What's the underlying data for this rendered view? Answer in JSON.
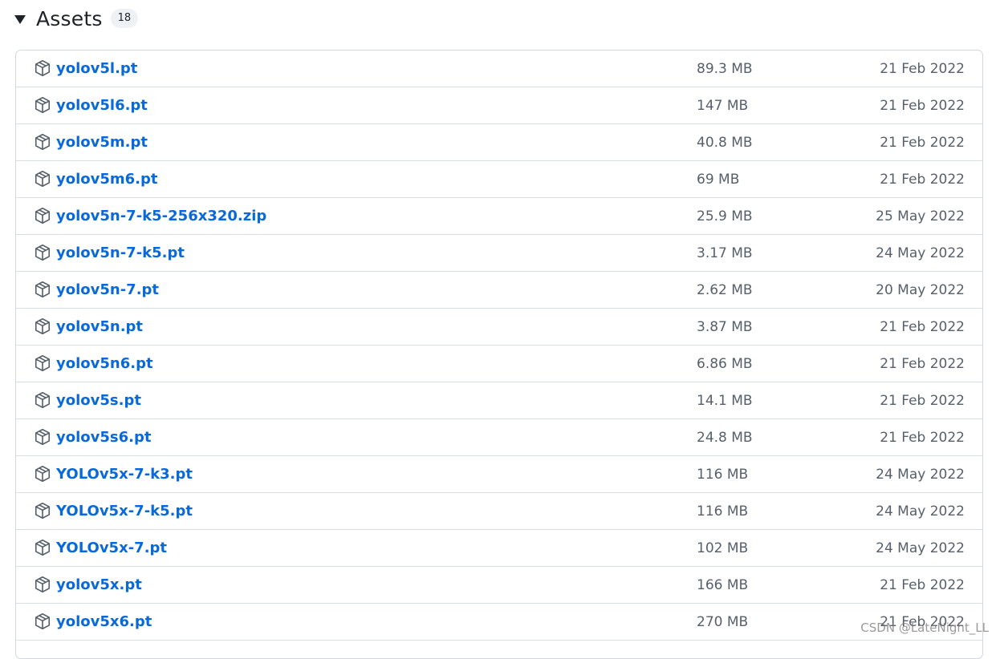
{
  "assets": {
    "title": "Assets",
    "count": "18",
    "items": [
      {
        "name": "yolov5l.pt",
        "size": "89.3 MB",
        "date": "21 Feb 2022"
      },
      {
        "name": "yolov5l6.pt",
        "size": "147 MB",
        "date": "21 Feb 2022"
      },
      {
        "name": "yolov5m.pt",
        "size": "40.8 MB",
        "date": "21 Feb 2022"
      },
      {
        "name": "yolov5m6.pt",
        "size": "69 MB",
        "date": "21 Feb 2022"
      },
      {
        "name": "yolov5n-7-k5-256x320.zip",
        "size": "25.9 MB",
        "date": "25 May 2022"
      },
      {
        "name": "yolov5n-7-k5.pt",
        "size": "3.17 MB",
        "date": "24 May 2022"
      },
      {
        "name": "yolov5n-7.pt",
        "size": "2.62 MB",
        "date": "20 May 2022"
      },
      {
        "name": "yolov5n.pt",
        "size": "3.87 MB",
        "date": "21 Feb 2022"
      },
      {
        "name": "yolov5n6.pt",
        "size": "6.86 MB",
        "date": "21 Feb 2022"
      },
      {
        "name": "yolov5s.pt",
        "size": "14.1 MB",
        "date": "21 Feb 2022"
      },
      {
        "name": "yolov5s6.pt",
        "size": "24.8 MB",
        "date": "21 Feb 2022"
      },
      {
        "name": "YOLOv5x-7-k3.pt",
        "size": "116 MB",
        "date": "24 May 2022"
      },
      {
        "name": "YOLOv5x-7-k5.pt",
        "size": "116 MB",
        "date": "24 May 2022"
      },
      {
        "name": "YOLOv5x-7.pt",
        "size": "102 MB",
        "date": "24 May 2022"
      },
      {
        "name": "yolov5x.pt",
        "size": "166 MB",
        "date": "21 Feb 2022"
      },
      {
        "name": "yolov5x6.pt",
        "size": "270 MB",
        "date": "21 Feb 2022"
      }
    ]
  },
  "icons": {
    "toggle": "caret-down-icon",
    "asset": "package-icon"
  },
  "colors": {
    "link": "#0969da",
    "muted": "#57606a",
    "border": "#d0d7de",
    "counter_bg": "#eff2f5"
  },
  "watermark": "CSDN @LateNight_LL"
}
